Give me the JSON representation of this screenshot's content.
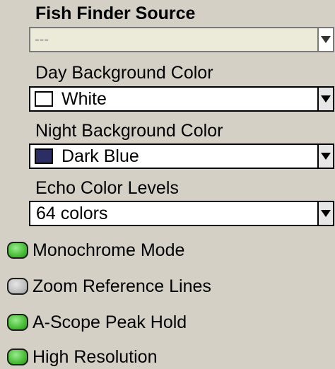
{
  "fish_finder_source": {
    "label": "Fish Finder Source",
    "value": "---",
    "disabled": true
  },
  "day_background": {
    "label": "Day Background Color",
    "value": "White",
    "swatch_color": "#ffffff"
  },
  "night_background": {
    "label": "Night Background Color",
    "value": "Dark Blue",
    "swatch_color": "#2b2d63"
  },
  "echo_levels": {
    "label": "Echo Color Levels",
    "value": "64 colors"
  },
  "toggles": [
    {
      "label": "Monochrome Mode",
      "state": "on",
      "indicator_color": "#4ec23c"
    },
    {
      "label": "Zoom Reference Lines",
      "state": "off",
      "indicator_color": "#bfbfbf"
    },
    {
      "label": "A-Scope Peak Hold",
      "state": "on",
      "indicator_color": "#4ec23c"
    },
    {
      "label": "High Resolution",
      "state": "on",
      "indicator_color": "#4ec23c"
    }
  ]
}
